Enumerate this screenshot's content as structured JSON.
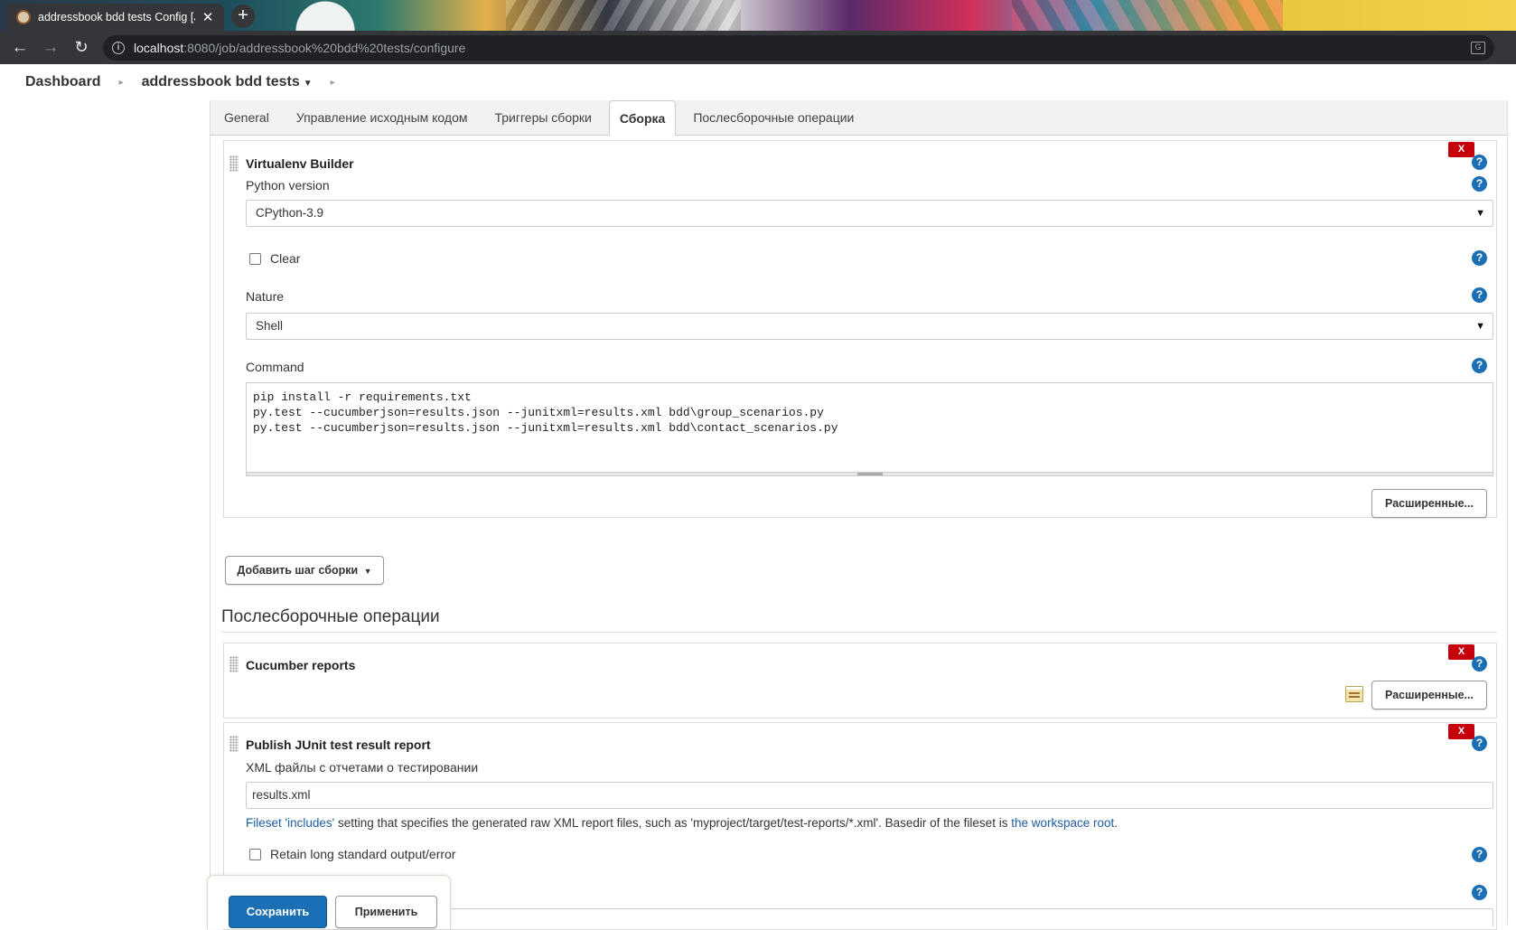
{
  "browser": {
    "tab_title": "addressbook bdd tests Config [Je",
    "new_tab": "+",
    "url_host": "localhost",
    "url_path": ":8080/job/addressbook%20bdd%20tests/configure"
  },
  "breadcrumbs": {
    "dashboard": "Dashboard",
    "job": "addressbook bdd tests"
  },
  "tabs": [
    "General",
    "Управление исходным кодом",
    "Триггеры сборки",
    "Сборка",
    "Послесборочные операции"
  ],
  "active_tab": "Сборка",
  "build": {
    "title": "Virtualenv Builder",
    "delete_label": "X",
    "python_version_label": "Python version",
    "python_version_value": "CPython-3.9",
    "clear_label": "Clear",
    "clear_checked": false,
    "nature_label": "Nature",
    "nature_value": "Shell",
    "command_label": "Command",
    "command_lines": "pip install -r requirements.txt\npy.test --cucumberjson=results.json --junitxml=results.xml bdd\\group_scenarios.py\npy.test --cucumberjson=results.json --junitxml=results.xml bdd\\contact_scenarios.py",
    "advanced_label": "Расширенные...",
    "add_step_label": "Добавить шаг сборки"
  },
  "post_build": {
    "heading": "Послесборочные операции",
    "cucumber": {
      "title": "Cucumber reports",
      "delete_label": "X",
      "advanced_label": "Расширенные..."
    },
    "junit": {
      "title": "Publish JUnit test result report",
      "delete_label": "X",
      "xml_label": "XML файлы с отчетами о тестировании",
      "xml_value": "results.xml",
      "note_link1": "Fileset 'includes'",
      "note_text": " setting that specifies the generated raw XML report files, such as 'myproject/target/test-reports/*.xml'. Basedir of the fileset is ",
      "note_link2": "the workspace root",
      "note_end": ".",
      "retain_label": "Retain long standard output/error",
      "retain_checked": false
    }
  },
  "footer": {
    "save_label": "Сохранить",
    "apply_label": "Применить"
  },
  "colors": {
    "delete_red": "#c4000a",
    "help_blue": "#1a6fb5",
    "link_blue": "#1c5ea0",
    "save_blue": "#1a6fb5"
  }
}
